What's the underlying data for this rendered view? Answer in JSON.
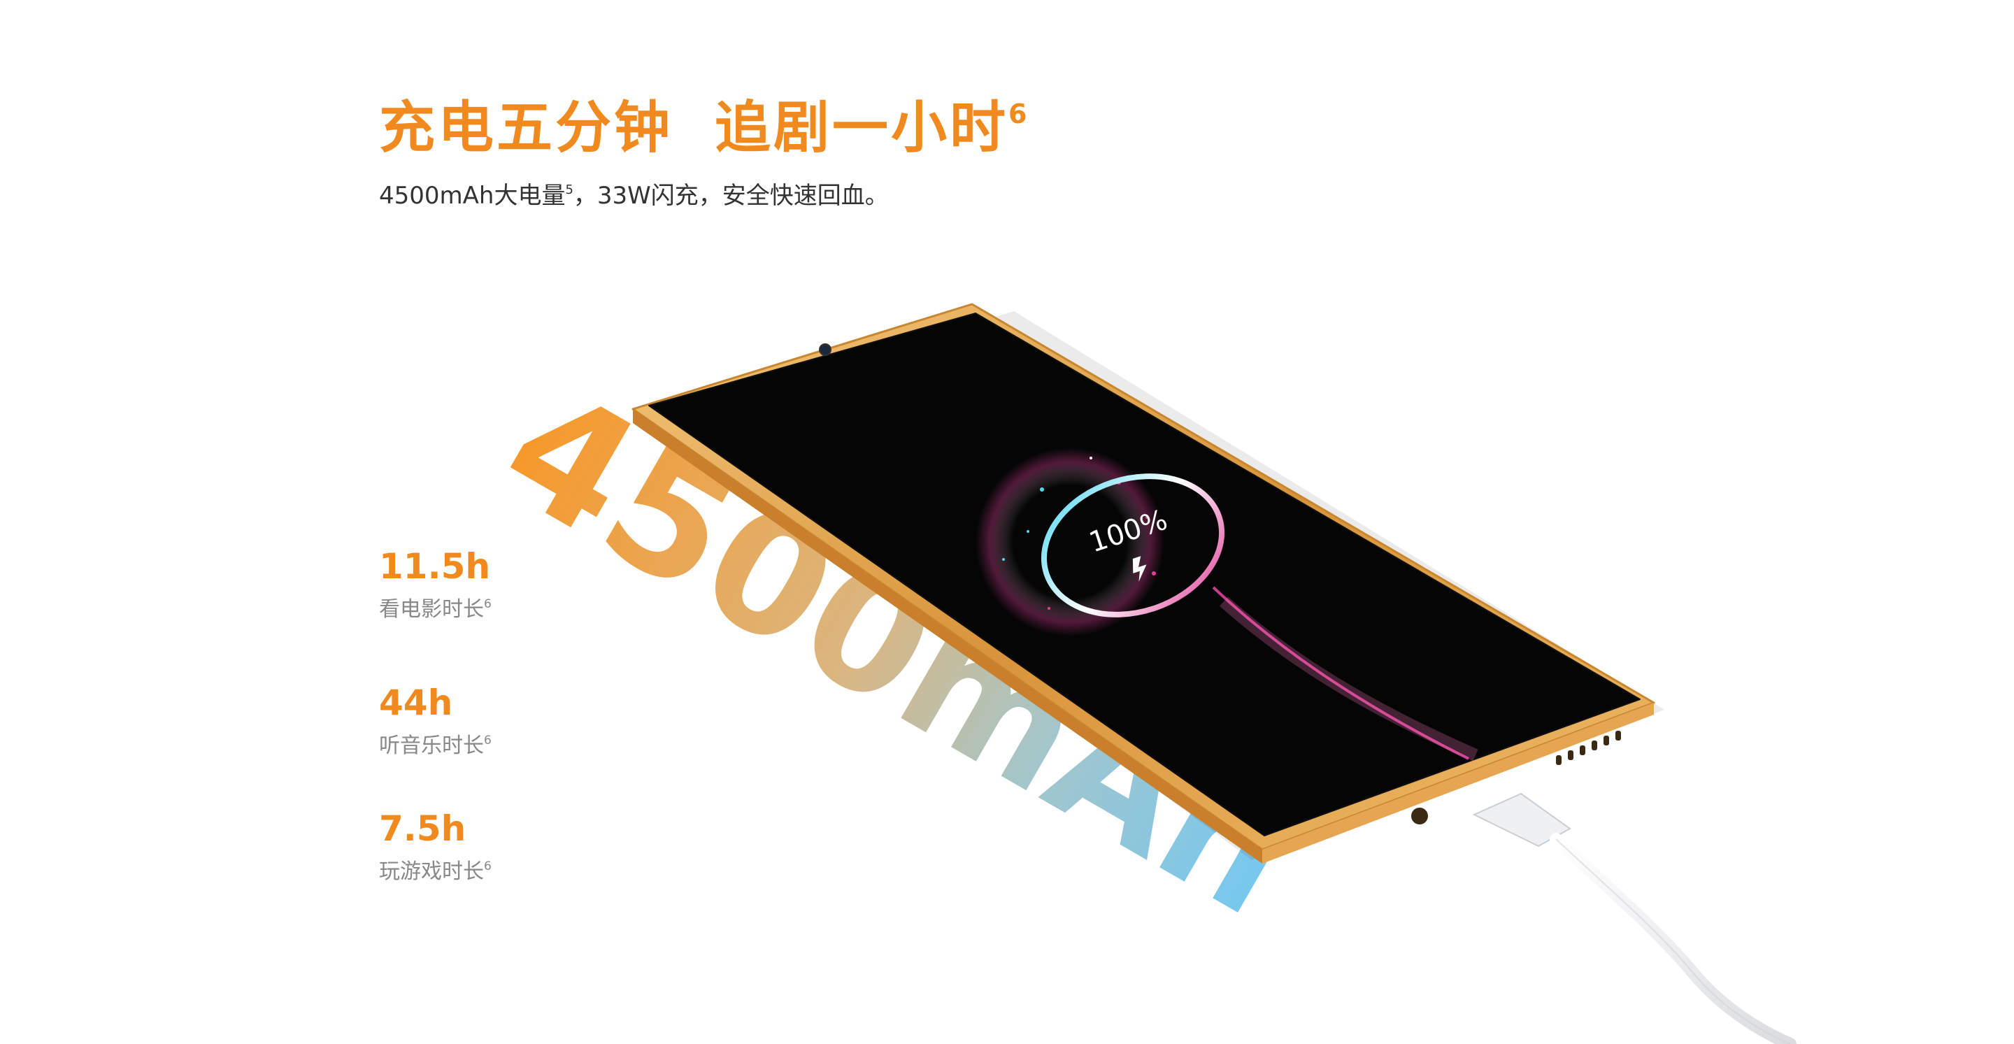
{
  "headline": {
    "part1": "充电五分钟",
    "part2": "追剧一小时",
    "footnote": "6"
  },
  "subline": {
    "capacity": "4500mAh大电量",
    "capacity_footnote": "5",
    "rest": "，33W闪充，安全快速回血。"
  },
  "stats": [
    {
      "value": "11.5h",
      "label": "看电影时长",
      "footnote": "6"
    },
    {
      "value": "44h",
      "label": "听音乐时长",
      "footnote": "6"
    },
    {
      "value": "7.5h",
      "label": "玩游戏时长",
      "footnote": "6"
    }
  ],
  "graphic": {
    "capacity_text": "4500mAh",
    "battery_percent": "100%",
    "colors": {
      "accent": "#f08a1f",
      "frame_gold": "#e3a54c",
      "screen": "#000000",
      "ring_cyan": "#4fd6f0",
      "ring_magenta": "#e0409a",
      "gradient_start": "#f7931e",
      "gradient_end": "#6ec6f0"
    },
    "icons": [
      "charging-bolt-icon",
      "front-camera-icon",
      "usb-c-cable"
    ]
  }
}
